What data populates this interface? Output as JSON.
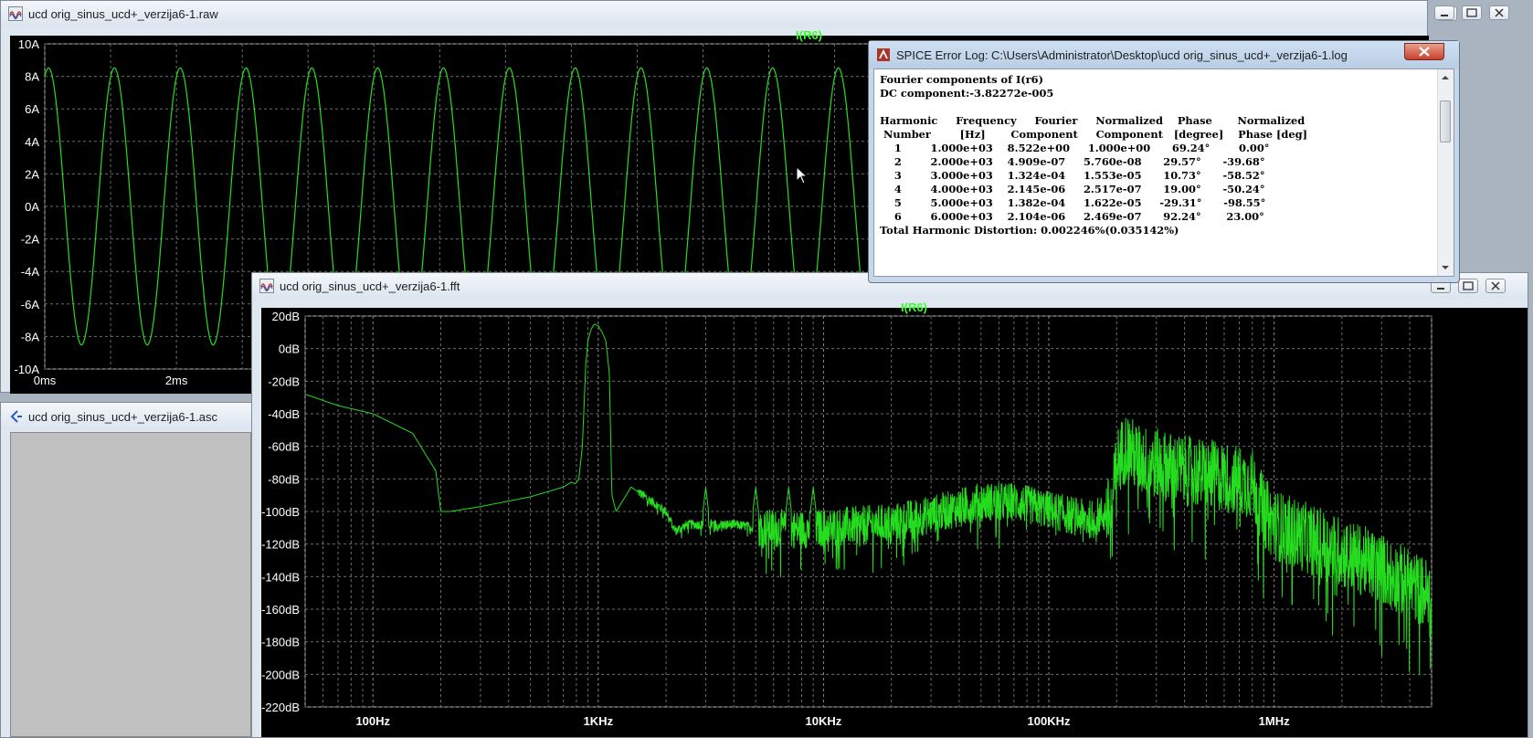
{
  "colors": {
    "trace": "#26dc1f",
    "grid": "#6b6b6b",
    "plot_bg": "#000000",
    "label": "#ffffff",
    "trace_title": "#37ff2e"
  },
  "raw_window": {
    "title": "ucd orig_sinus_ucd+_verzija6-1.raw",
    "icon": "waveform-icon",
    "trace_name": "I(R6)",
    "chart_data": {
      "type": "line",
      "title": "I(R6)",
      "y_ticks": [
        "10A",
        "8A",
        "6A",
        "4A",
        "2A",
        "0A",
        "-2A",
        "-4A",
        "-6A",
        "-8A",
        "-10A"
      ],
      "ylim": [
        -10,
        10
      ],
      "x_ticks": [
        "0ms",
        "2ms"
      ],
      "xlim": [
        0,
        21
      ],
      "signal": {
        "amplitude": 8.522,
        "frequency_hz": 1000,
        "phase_deg": 69.24
      }
    }
  },
  "asc_window": {
    "title": "ucd orig_sinus_ucd+_verzija6-1.asc",
    "icon": "schematic-icon"
  },
  "fft_window": {
    "title": "ucd orig_sinus_ucd+_verzija6-1.fft",
    "icon": "waveform-icon",
    "trace_name": "I(R6)",
    "chart_data": {
      "type": "line",
      "title": "I(R6)",
      "y_scale": "linear",
      "x_scale": "log",
      "y_ticks": [
        "20dB",
        "0dB",
        "-20dB",
        "-40dB",
        "-60dB",
        "-80dB",
        "-100dB",
        "-120dB",
        "-140dB",
        "-160dB",
        "-180dB",
        "-200dB",
        "-220dB"
      ],
      "ylim": [
        -220,
        20
      ],
      "x_ticks": [
        "100Hz",
        "1KHz",
        "10KHz",
        "100KHz",
        "1MHz"
      ],
      "xlim_hz": [
        50,
        5000000
      ],
      "envelope": {
        "x": [
          50,
          70,
          100,
          150,
          190,
          200,
          220,
          300,
          500,
          700,
          760,
          790,
          820,
          850,
          880,
          900,
          930,
          960,
          1000,
          1040,
          1080,
          1120,
          1150,
          1200,
          1400,
          2000,
          2200,
          2500,
          4000,
          5000,
          8000,
          10000,
          20000,
          30000,
          50000,
          70000,
          100000,
          150000,
          190000,
          200000,
          220000,
          250000,
          400000,
          600000,
          800000,
          900000,
          1000000,
          2000000,
          3000000,
          5000000
        ],
        "y": [
          -28,
          -35,
          -40,
          -52,
          -75,
          -100,
          -100,
          -97,
          -91,
          -85,
          -82,
          -83,
          -80,
          -60,
          -10,
          5,
          12,
          15,
          14,
          10,
          5,
          -15,
          -90,
          -100,
          -85,
          -100,
          -112,
          -108,
          -108,
          -110,
          -111,
          -110,
          -107,
          -102,
          -94,
          -94,
          -99,
          -105,
          -100,
          -70,
          -60,
          -68,
          -75,
          -79,
          -83,
          -100,
          -108,
          -125,
          -135,
          -152
        ]
      },
      "harmonic_spikes_hz": [
        3000,
        5000,
        7000,
        9000
      ]
    }
  },
  "log_window": {
    "title": "SPICE Error Log: C:\\Users\\Administrator\\Desktop\\ucd orig_sinus_ucd+_verzija6-1.log",
    "icon": "spice-log-icon",
    "lines": [
      "Fourier components of I(r6)",
      "DC component:-3.82272e-005",
      "",
      "Harmonic     Frequency     Fourier     Normalized    Phase       Normalized",
      " Number        [Hz]       Component     Component   [degree]    Phase [deg]",
      "    1        1.000e+03    8.522e+00     1.000e+00      69.24°        0.00°",
      "    2        2.000e+03    4.909e-07     5.760e-08      29.57°      -39.68°",
      "    3        3.000e+03    1.324e-04     1.553e-05      10.73°      -58.52°",
      "    4        4.000e+03    2.145e-06     2.517e-07      19.00°      -50.24°",
      "    5        5.000e+03    1.382e-04     1.622e-05     -29.31°      -98.55°",
      "    6        6.000e+03    2.104e-06     2.469e-07      92.24°       23.00°",
      "Total Harmonic Distortion: 0.002246%(0.035142%)"
    ]
  }
}
